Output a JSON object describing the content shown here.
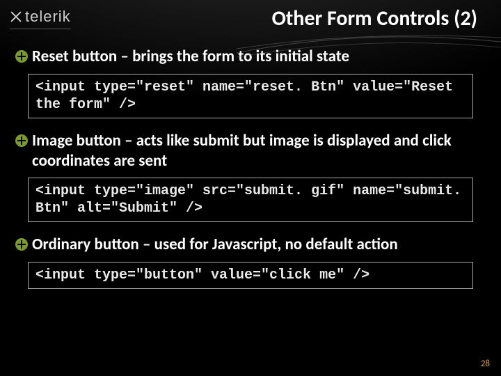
{
  "brand": {
    "name": "telerik"
  },
  "slide": {
    "title": "Other Form Controls (2)",
    "page_number": "28"
  },
  "bullets": [
    {
      "lead": "Reset",
      "rest": " button – brings the form to its initial state",
      "code": "<input type=\"reset\" name=\"reset. Btn\" value=\"Reset the form\" />"
    },
    {
      "lead": "Image",
      "rest": " button – acts like submit but image is displayed and click coordinates are sent",
      "code": "<input type=\"image\" src=\"submit. gif\" name=\"submit. Btn\" alt=\"Submit\" />"
    },
    {
      "lead": "Ordinary",
      "rest": " button – used for Javascript, no default action",
      "code": "<input type=\"button\" value=\"click me\" />"
    }
  ]
}
